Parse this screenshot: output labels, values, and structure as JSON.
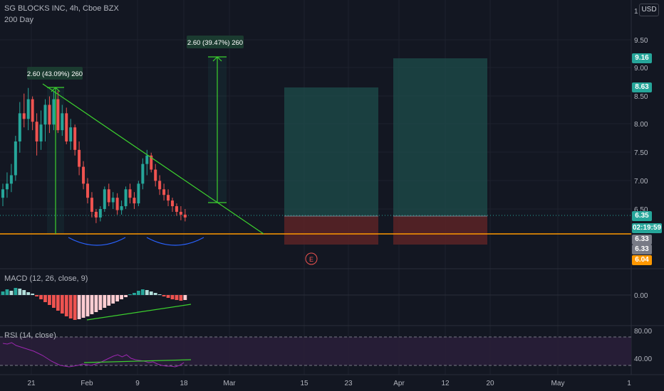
{
  "header": {
    "title": "SG BLOCKS INC, 4h, Cboe BZX",
    "ma_label": "200 Day",
    "currency": "USD"
  },
  "macd": {
    "label": "MACD (12, 26, close, 9)"
  },
  "rsi": {
    "label": "RSI (14, close)"
  },
  "price_axis": {
    "ticks": [
      "1",
      "9.50",
      "9.00",
      "8.50",
      "8.00",
      "7.50",
      "7.00",
      "6.50"
    ],
    "tick_values": [
      10,
      9.5,
      9.0,
      8.5,
      8.0,
      7.5,
      7.0,
      6.5
    ]
  },
  "price_tags": {
    "target_high": "9.16",
    "target_low": "8.63",
    "close": "6.35",
    "timer": "02:19:59",
    "level_a": "6.33",
    "level_b": "6.33",
    "ma_value": "6.04"
  },
  "macd_axis": {
    "ticks": [
      "0.00"
    ]
  },
  "rsi_axis": {
    "ticks": [
      "80.00",
      "40.00"
    ]
  },
  "time_axis": {
    "ticks": [
      "21",
      "Feb",
      "9",
      "18",
      "Mar",
      "15",
      "23",
      "Apr",
      "12",
      "20",
      "May",
      "1"
    ]
  },
  "measurements": [
    "2.60 (43.09%) 260",
    "2.60 (39.47%) 260"
  ],
  "event_marker": "E",
  "colors": {
    "background": "#131722",
    "up": "#26a69a",
    "down": "#ef5350",
    "trendline": "#3cd02e",
    "support": "#ff9800",
    "rsi_line": "#9c27b0",
    "bowl": "#2962ff",
    "profit_zone": "#1e4d4b",
    "loss_zone": "#5c2326"
  },
  "chart_data": {
    "type": "candlestick",
    "instrument": "SG BLOCKS INC",
    "interval": "4h",
    "exchange": "Cboe BZX",
    "ohlc_approx": [
      [
        6.7,
        6.95,
        6.55,
        6.85
      ],
      [
        6.85,
        7.15,
        6.7,
        6.95
      ],
      [
        6.95,
        7.3,
        6.8,
        7.1
      ],
      [
        7.1,
        7.8,
        7.0,
        7.7
      ],
      [
        7.7,
        8.4,
        7.5,
        8.2
      ],
      [
        8.2,
        8.55,
        7.95,
        8.1
      ],
      [
        8.1,
        8.65,
        7.9,
        8.45
      ],
      [
        8.45,
        8.5,
        7.9,
        8.05
      ],
      [
        8.05,
        8.2,
        7.45,
        7.7
      ],
      [
        7.7,
        8.25,
        7.55,
        8.0
      ],
      [
        8.0,
        8.45,
        7.7,
        8.35
      ],
      [
        8.35,
        8.5,
        7.85,
        8.0
      ],
      [
        8.0,
        8.6,
        7.9,
        8.45
      ],
      [
        8.45,
        8.6,
        7.85,
        7.9
      ],
      [
        7.9,
        8.35,
        7.8,
        8.2
      ],
      [
        8.2,
        8.3,
        7.65,
        7.7
      ],
      [
        7.7,
        8.1,
        7.55,
        7.95
      ],
      [
        7.95,
        8.0,
        7.45,
        7.55
      ],
      [
        7.55,
        7.7,
        7.1,
        7.25
      ],
      [
        7.25,
        7.35,
        6.85,
        6.95
      ],
      [
        6.95,
        7.05,
        6.6,
        6.7
      ],
      [
        6.7,
        6.8,
        6.35,
        6.45
      ],
      [
        6.45,
        6.5,
        6.25,
        6.35
      ],
      [
        6.35,
        6.55,
        6.28,
        6.5
      ],
      [
        6.5,
        6.9,
        6.45,
        6.85
      ],
      [
        6.85,
        6.95,
        6.55,
        6.62
      ],
      [
        6.62,
        6.8,
        6.5,
        6.7
      ],
      [
        6.7,
        6.78,
        6.4,
        6.48
      ],
      [
        6.48,
        6.65,
        6.4,
        6.55
      ],
      [
        6.55,
        6.9,
        6.5,
        6.85
      ],
      [
        6.85,
        6.95,
        6.6,
        6.7
      ],
      [
        6.7,
        6.8,
        6.5,
        6.6
      ],
      [
        6.6,
        7.0,
        6.55,
        6.95
      ],
      [
        6.95,
        7.4,
        6.85,
        7.3
      ],
      [
        7.3,
        7.55,
        7.1,
        7.45
      ],
      [
        7.45,
        7.5,
        7.15,
        7.2
      ],
      [
        7.2,
        7.3,
        6.9,
        7.0
      ],
      [
        7.0,
        7.1,
        6.75,
        6.85
      ],
      [
        6.85,
        6.95,
        6.65,
        6.75
      ],
      [
        6.75,
        6.85,
        6.55,
        6.65
      ],
      [
        6.65,
        6.7,
        6.45,
        6.55
      ],
      [
        6.55,
        6.6,
        6.38,
        6.45
      ],
      [
        6.45,
        6.55,
        6.3,
        6.4
      ],
      [
        6.4,
        6.5,
        6.28,
        6.35
      ]
    ],
    "trendline": [
      {
        "date": "~Jan 22",
        "price": 8.6
      },
      {
        "date": "~Mar 2",
        "price": 6.33
      }
    ],
    "support_level": 6.33,
    "measure_1": {
      "label": "2.60 (43.09%) 260",
      "from": 6.33,
      "to": 8.6
    },
    "measure_2": {
      "label": "2.60 (39.47%) 260",
      "from": 6.6,
      "to": 9.16
    },
    "position_1": {
      "entry": 6.35,
      "target": 8.63,
      "stop": 6.13
    },
    "position_2": {
      "entry": 6.35,
      "target": 9.16,
      "stop": 6.13
    },
    "macd_hist_approx": [
      0.05,
      0.08,
      0.06,
      0.1,
      0.09,
      0.07,
      0.04,
      0.02,
      -0.02,
      -0.06,
      -0.1,
      -0.14,
      -0.18,
      -0.22,
      -0.26,
      -0.3,
      -0.33,
      -0.35,
      -0.34,
      -0.32,
      -0.3,
      -0.27,
      -0.24,
      -0.21,
      -0.18,
      -0.15,
      -0.12,
      -0.09,
      -0.06,
      -0.03,
      0.0,
      0.03,
      0.06,
      0.08,
      0.07,
      0.05,
      0.03,
      0.01,
      -0.02,
      -0.04,
      -0.06,
      -0.07,
      -0.08,
      -0.07
    ],
    "rsi_approx": [
      71,
      70,
      72,
      68,
      66,
      64,
      62,
      60,
      57,
      54,
      50,
      46,
      43,
      40,
      39,
      38,
      39,
      40,
      42,
      41,
      40,
      42,
      44,
      47,
      50,
      53,
      55,
      52,
      55,
      50,
      48,
      47,
      46,
      44,
      45,
      42,
      40,
      39,
      39,
      38,
      40,
      44
    ]
  }
}
